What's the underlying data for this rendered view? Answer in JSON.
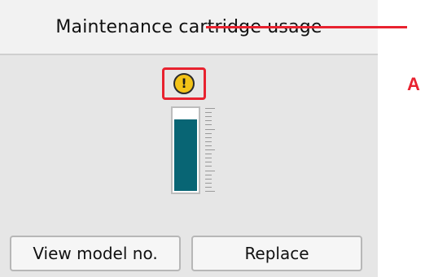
{
  "screen": {
    "title": "Maintenance cartridge usage"
  },
  "gauge": {
    "fill_level_percent": 88,
    "fill_color": "#086574",
    "warning_icon": "exclamation-warning-icon",
    "warning_glyph": "!"
  },
  "callout": {
    "label": "A",
    "color": "#e8222f"
  },
  "buttons": {
    "view_model_label": "View model no.",
    "replace_label": "Replace"
  }
}
